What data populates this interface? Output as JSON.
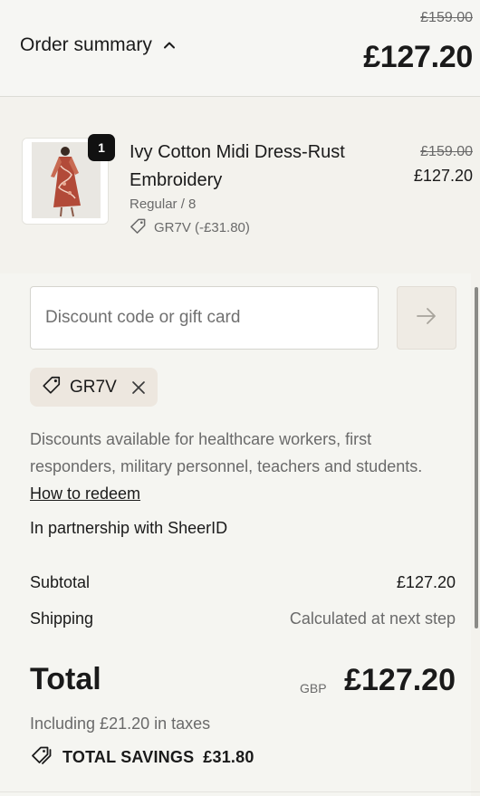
{
  "header": {
    "toggle_label": "Order summary",
    "original_total": "£159.00",
    "total": "£127.20"
  },
  "item": {
    "quantity": "1",
    "name": "Ivy Cotton Midi Dress-Rust Embroidery",
    "variant": "Regular / 8",
    "discount": "GR7V (-£31.80)",
    "original_price": "£159.00",
    "price": "£127.20"
  },
  "discount_form": {
    "placeholder": "Discount code or gift card",
    "value": ""
  },
  "applied_code": "GR7V",
  "note": {
    "text": "Discounts available for healthcare workers, first responders, military personnel, teachers and students.",
    "link": "How to redeem"
  },
  "partner": "In partnership with SheerID",
  "summary": {
    "subtotal_label": "Subtotal",
    "subtotal_value": "£127.20",
    "shipping_label": "Shipping",
    "shipping_value": "Calculated at next step",
    "total_label": "Total",
    "currency": "GBP",
    "total_value": "£127.20",
    "taxes": "Including £21.20 in taxes",
    "savings_label": "TOTAL SAVINGS",
    "savings_value": "£31.80"
  },
  "colors": {
    "background": "#f3f2ed",
    "muted_text": "#6a6a6a",
    "chip": "#ede7df",
    "apply_button": "#efebe4"
  },
  "icons": {
    "toggle": "chevron-up-icon",
    "item_discount": "tag-icon",
    "apply": "arrow-right-icon",
    "chip": "tag-icon",
    "chip_remove": "close-icon",
    "savings": "tags-icon"
  }
}
